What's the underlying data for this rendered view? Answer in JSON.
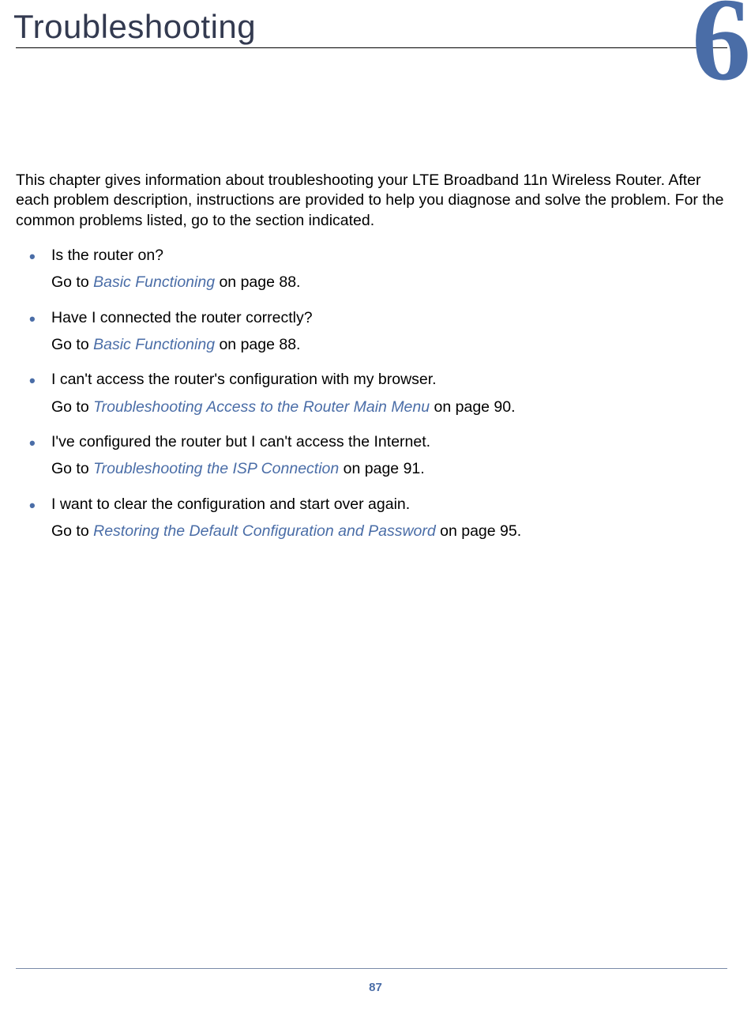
{
  "chapter": {
    "number": "6",
    "title": "Troubleshooting"
  },
  "intro": "This chapter gives information about troubleshooting your LTE Broadband 11n Wireless Router. After each problem description, instructions are provided to help you diagnose and solve the problem. For the common problems listed, go to the section indicated.",
  "items": [
    {
      "question": "Is the router on?",
      "goto_prefix": "Go to ",
      "link_text": "Basic Functioning",
      "goto_suffix": " on page 88."
    },
    {
      "question": "Have I connected the router correctly?",
      "goto_prefix": "Go to ",
      "link_text": "Basic Functioning",
      "goto_suffix": " on page 88."
    },
    {
      "question": "I can't access the router's configuration with my browser.",
      "goto_prefix": "Go to ",
      "link_text": "Troubleshooting Access to the Router Main Menu",
      "goto_suffix": " on page 90."
    },
    {
      "question": "I've configured the router but I can't access the Internet.",
      "goto_prefix": "Go to ",
      "link_text": "Troubleshooting the ISP Connection",
      "goto_suffix": " on page 91."
    },
    {
      "question": "I want to clear the configuration and start over again.",
      "goto_prefix": "Go to ",
      "link_text": "Restoring the Default Configuration and Password",
      "goto_suffix": " on page 95."
    }
  ],
  "page_number": "87"
}
